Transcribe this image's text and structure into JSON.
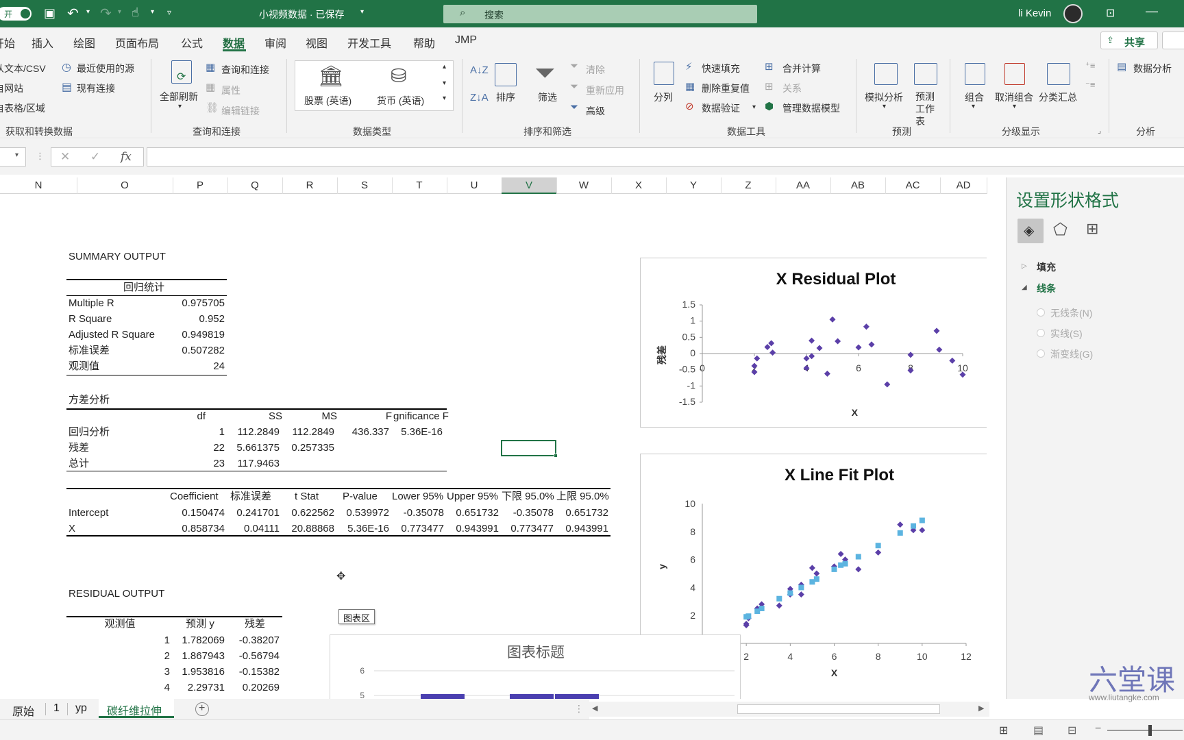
{
  "titlebar": {
    "autosave": "开",
    "filename": "小视频数据 · 已保存",
    "search_placeholder": "搜索",
    "user": "li Kevin"
  },
  "menu": {
    "tabs": [
      "开始",
      "插入",
      "绘图",
      "页面布局",
      "公式",
      "数据",
      "审阅",
      "视图",
      "开发工具",
      "帮助",
      "JMP"
    ],
    "active": "数据",
    "share": "共享"
  },
  "ribbon": {
    "get": {
      "from_text": "从文本/CSV",
      "recent": "最近使用的源",
      "web": "自网站",
      "existing": "现有连接",
      "table": "自表格/区域",
      "group": "获取和转换数据"
    },
    "query": {
      "refresh_all": "全部刷新",
      "queries": "查询和连接",
      "props": "属性",
      "edit_links": "编辑链接",
      "group": "查询和连接"
    },
    "types": {
      "stocks": "股票 (英语)",
      "currency": "货币 (英语)",
      "group": "数据类型"
    },
    "sort": {
      "sort": "排序",
      "filter": "筛选",
      "clear": "清除",
      "reapply": "重新应用",
      "advanced": "高级",
      "group": "排序和筛选"
    },
    "tools": {
      "split": "分列",
      "flash": "快速填充",
      "dup": "删除重复值",
      "validate": "数据验证",
      "consolidate": "合并计算",
      "relations": "关系",
      "model": "管理数据模型",
      "group": "数据工具"
    },
    "forecast": {
      "whatif": "模拟分析",
      "sheet": "预测工作表",
      "group": "预测"
    },
    "outline": {
      "group_btn": "组合",
      "ungroup": "取消组合",
      "subtotal": "分类汇总",
      "group": "分级显示"
    },
    "analysis": {
      "data_analysis": "数据分析",
      "group": "分析"
    }
  },
  "formula": {
    "fx": "fx"
  },
  "columns": [
    "N",
    "O",
    "P",
    "Q",
    "R",
    "S",
    "T",
    "U",
    "V",
    "W",
    "X",
    "Y",
    "Z",
    "AA",
    "AB",
    "AC",
    "AD"
  ],
  "summary": {
    "title": "SUMMARY OUTPUT",
    "reg_stats_header": "回归统计",
    "reg_stats": [
      [
        "Multiple R",
        "0.975705"
      ],
      [
        "R Square",
        "0.952"
      ],
      [
        "Adjusted R Square",
        "0.949819"
      ],
      [
        "标准误差",
        "0.507282"
      ],
      [
        "观测值",
        "24"
      ]
    ],
    "anova_title": "方差分析",
    "anova_header": [
      "df",
      "SS",
      "MS",
      "F",
      "gnificance F"
    ],
    "anova_rows": [
      [
        "回归分析",
        "1",
        "112.2849",
        "112.2849",
        "436.337",
        "5.36E-16"
      ],
      [
        "残差",
        "22",
        "5.661375",
        "0.257335",
        "",
        ""
      ],
      [
        "总计",
        "23",
        "117.9463",
        "",
        "",
        ""
      ]
    ],
    "coef_header": [
      "Coefficient",
      "标准误差",
      "t Stat",
      "P-value",
      "Lower 95%",
      "Upper 95%",
      "下限 95.0%",
      "上限 95.0%"
    ],
    "coef_rows": [
      [
        "Intercept",
        "0.150474",
        "0.241701",
        "0.622562",
        "0.539972",
        "-0.35078",
        "0.651732",
        "-0.35078",
        "0.651732"
      ],
      [
        "X",
        "0.858734",
        "0.04111",
        "20.88868",
        "5.36E-16",
        "0.773477",
        "0.943991",
        "0.773477",
        "0.943991"
      ]
    ],
    "resid_title": "RESIDUAL OUTPUT",
    "resid_header": [
      "观测值",
      "预测 y",
      "残差"
    ],
    "resid_rows": [
      [
        "1",
        "1.782069",
        "-0.38207"
      ],
      [
        "2",
        "1.867943",
        "-0.56794"
      ],
      [
        "3",
        "1.953816",
        "-0.15382"
      ],
      [
        "4",
        "2.29731",
        "0.20269"
      ]
    ]
  },
  "tooltip": "图表区",
  "chart_data": [
    {
      "type": "scatter",
      "title": "X Residual Plot",
      "xlabel": "X",
      "ylabel": "残差",
      "xlim": [
        0,
        10
      ],
      "ylim": [
        -1.5,
        1.5
      ],
      "x": [
        2,
        2,
        2.1,
        2.5,
        2.65,
        2.7,
        4,
        4,
        4.2,
        4.2,
        4.5,
        4.8,
        5,
        5.2,
        6,
        6.3,
        6.5,
        7.1,
        8,
        8,
        9,
        9.1,
        9.6,
        10
      ],
      "y": [
        -0.38,
        -0.57,
        -0.15,
        0.2,
        0.32,
        0.03,
        -0.15,
        -0.45,
        -0.08,
        0.4,
        0.17,
        -0.62,
        1.05,
        0.38,
        0.19,
        0.83,
        0.28,
        -0.95,
        -0.04,
        -0.52,
        0.7,
        0.12,
        -0.22,
        -0.65
      ]
    },
    {
      "type": "scatter",
      "title": "X Line Fit  Plot",
      "xlabel": "X",
      "ylabel": "y",
      "xlim": [
        0,
        12
      ],
      "ylim": [
        0,
        10
      ],
      "series": [
        {
          "x": [
            2,
            2,
            2.1,
            2.5,
            2.7,
            3.5,
            4,
            4,
            4.5,
            4.5,
            5,
            5.2,
            6,
            6.3,
            6.5,
            7.1,
            8,
            9,
            9.6,
            10
          ],
          "y": [
            1.4,
            1.3,
            1.8,
            2.5,
            2.8,
            2.7,
            3.9,
            3.5,
            4.2,
            3.5,
            5.4,
            5,
            5.5,
            6.4,
            6,
            5.3,
            6.5,
            8.5,
            8.1,
            8.1
          ]
        },
        {
          "x": [
            2,
            2.1,
            2.5,
            2.7,
            3.5,
            4,
            4.5,
            5,
            5.2,
            6,
            6.3,
            6.5,
            7.1,
            8,
            9,
            9.6,
            10
          ],
          "y": [
            1.9,
            1.95,
            2.3,
            2.5,
            3.2,
            3.6,
            4.0,
            4.4,
            4.6,
            5.3,
            5.6,
            5.7,
            6.2,
            7.0,
            7.9,
            8.4,
            8.8
          ]
        }
      ]
    },
    {
      "type": "bar",
      "title": "图表标题",
      "yticks": [
        "6",
        "5"
      ]
    }
  ],
  "pane": {
    "title": "设置形状格式",
    "fill": "填充",
    "line": "线条",
    "options": [
      "无线条(N)",
      "实线(S)",
      "渐变线(G)"
    ]
  },
  "sheets": {
    "tabs": [
      "原始",
      "1",
      "yp",
      "碳纤维拉伸"
    ],
    "active": "碳纤维拉伸"
  },
  "watermark": {
    "brand": "六堂课",
    "url": "www.liutangke.com"
  },
  "colors": {
    "excel_green": "#217346",
    "marker_dark": "#5b3fa8",
    "marker_light": "#5cb4e0"
  }
}
